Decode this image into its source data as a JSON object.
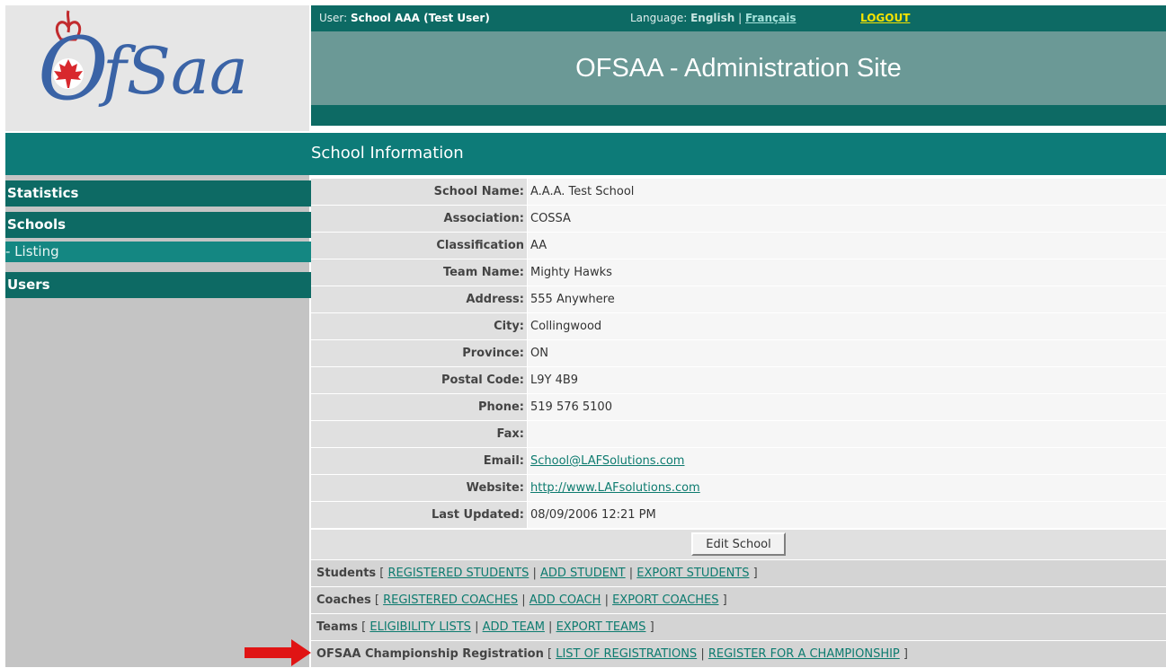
{
  "header": {
    "user_label": "User: ",
    "user_name": "School AAA (Test User)",
    "language_label": "Language: ",
    "language_current": "English",
    "language_sep": " | ",
    "language_alt": "Français",
    "logout": "LOGOUT",
    "site_title": "OFSAA - Administration Site",
    "logo_text": "OfSAA"
  },
  "section_title": "School Information",
  "sidebar": {
    "statistics": "Statistics",
    "schools": "Schools",
    "listing": "- Listing",
    "users": "Users"
  },
  "school": {
    "rows": [
      {
        "label": "School Name:",
        "value": "A.A.A. Test School"
      },
      {
        "label": "Association:",
        "value": "COSSA"
      },
      {
        "label": "Classification",
        "value": "AA"
      },
      {
        "label": "Team Name:",
        "value": "Mighty Hawks"
      },
      {
        "label": "Address:",
        "value": "555 Anywhere"
      },
      {
        "label": "City:",
        "value": "Collingwood"
      },
      {
        "label": "Province:",
        "value": "ON"
      },
      {
        "label": "Postal Code:",
        "value": "L9Y 4B9"
      },
      {
        "label": "Phone:",
        "value": "519 576 5100"
      },
      {
        "label": "Fax:",
        "value": ""
      },
      {
        "label": "Email:",
        "value": "School@LAFSolutions.com"
      },
      {
        "label": "Website:",
        "value": "http://www.LAFsolutions.com"
      },
      {
        "label": "Last Updated:",
        "value": "08/09/2006 12:21 PM"
      }
    ],
    "edit_button": "Edit School"
  },
  "link_rows": {
    "students": {
      "label": "Students",
      "links": [
        "REGISTERED STUDENTS",
        "ADD STUDENT",
        "EXPORT STUDENTS"
      ]
    },
    "coaches": {
      "label": "Coaches",
      "links": [
        "REGISTERED COACHES",
        "ADD COACH",
        "EXPORT COACHES"
      ]
    },
    "teams": {
      "label": "Teams",
      "links": [
        "ELIGIBILITY LISTS",
        "ADD TEAM",
        "EXPORT TEAMS"
      ]
    },
    "championship": {
      "label": "OFSAA Championship Registration",
      "links": [
        "LIST OF REGISTRATIONS",
        "REGISTER FOR A CHAMPIONSHIP"
      ]
    }
  },
  "punct": {
    "open": " [ ",
    "sep": " | ",
    "close": " ]"
  },
  "colors": {
    "header_dark": "#0d6a64",
    "banner": "#6b9996",
    "section": "#0d7b78",
    "link": "#0d7b6f",
    "logout": "#f4e300",
    "arrow": "#e01414",
    "logo_blue": "#3a63a6",
    "maple_red": "#d8282d"
  },
  "icons": {
    "arrow": "red-arrow-icon",
    "maple_leaf": "maple-leaf-icon",
    "trillium": "trillium-icon"
  }
}
